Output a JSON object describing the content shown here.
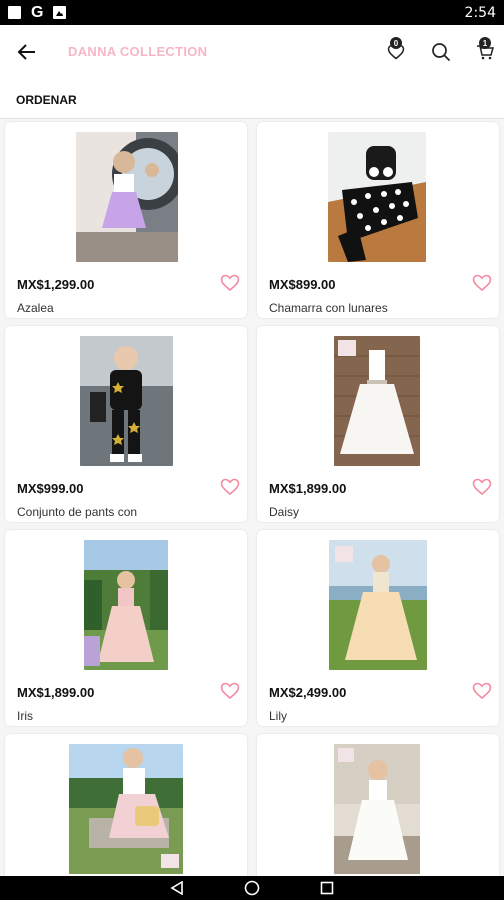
{
  "status_bar": {
    "time": "2:54",
    "icon_g": "G"
  },
  "header": {
    "brand": "DANNA COLLECTION",
    "wishlist_badge": "0",
    "cart_badge": "1",
    "brand_color": "#f7b6c4"
  },
  "sort": {
    "label": "ORDENAR"
  },
  "products": [
    {
      "price": "MX$1,299.00",
      "name": "Azalea"
    },
    {
      "price": "MX$899.00",
      "name": "Chamarra con lunares"
    },
    {
      "price": "MX$999.00",
      "name": "Conjunto de pants con"
    },
    {
      "price": "MX$1,899.00",
      "name": "Daisy"
    },
    {
      "price": "MX$1,899.00",
      "name": "Iris"
    },
    {
      "price": "MX$2,499.00",
      "name": "Lily"
    },
    {
      "price": "",
      "name": ""
    },
    {
      "price": "",
      "name": ""
    }
  ],
  "colors": {
    "heart": "#f48aa0",
    "accent": "#f7b6c4"
  }
}
